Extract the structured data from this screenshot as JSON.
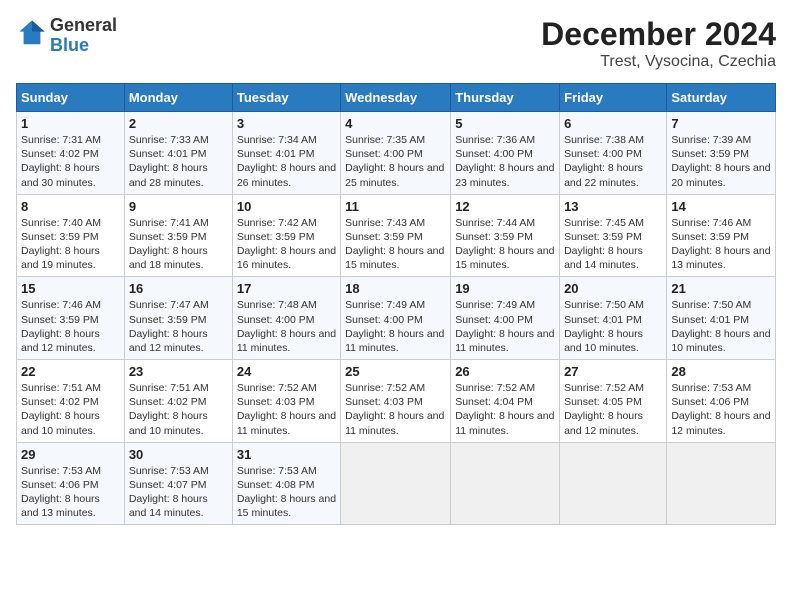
{
  "logo": {
    "general": "General",
    "blue": "Blue"
  },
  "title": "December 2024",
  "subtitle": "Trest, Vysocina, Czechia",
  "weekdays": [
    "Sunday",
    "Monday",
    "Tuesday",
    "Wednesday",
    "Thursday",
    "Friday",
    "Saturday"
  ],
  "weeks": [
    [
      {
        "day": "1",
        "sunrise": "Sunrise: 7:31 AM",
        "sunset": "Sunset: 4:02 PM",
        "daylight": "Daylight: 8 hours and 30 minutes."
      },
      {
        "day": "2",
        "sunrise": "Sunrise: 7:33 AM",
        "sunset": "Sunset: 4:01 PM",
        "daylight": "Daylight: 8 hours and 28 minutes."
      },
      {
        "day": "3",
        "sunrise": "Sunrise: 7:34 AM",
        "sunset": "Sunset: 4:01 PM",
        "daylight": "Daylight: 8 hours and 26 minutes."
      },
      {
        "day": "4",
        "sunrise": "Sunrise: 7:35 AM",
        "sunset": "Sunset: 4:00 PM",
        "daylight": "Daylight: 8 hours and 25 minutes."
      },
      {
        "day": "5",
        "sunrise": "Sunrise: 7:36 AM",
        "sunset": "Sunset: 4:00 PM",
        "daylight": "Daylight: 8 hours and 23 minutes."
      },
      {
        "day": "6",
        "sunrise": "Sunrise: 7:38 AM",
        "sunset": "Sunset: 4:00 PM",
        "daylight": "Daylight: 8 hours and 22 minutes."
      },
      {
        "day": "7",
        "sunrise": "Sunrise: 7:39 AM",
        "sunset": "Sunset: 3:59 PM",
        "daylight": "Daylight: 8 hours and 20 minutes."
      }
    ],
    [
      {
        "day": "8",
        "sunrise": "Sunrise: 7:40 AM",
        "sunset": "Sunset: 3:59 PM",
        "daylight": "Daylight: 8 hours and 19 minutes."
      },
      {
        "day": "9",
        "sunrise": "Sunrise: 7:41 AM",
        "sunset": "Sunset: 3:59 PM",
        "daylight": "Daylight: 8 hours and 18 minutes."
      },
      {
        "day": "10",
        "sunrise": "Sunrise: 7:42 AM",
        "sunset": "Sunset: 3:59 PM",
        "daylight": "Daylight: 8 hours and 16 minutes."
      },
      {
        "day": "11",
        "sunrise": "Sunrise: 7:43 AM",
        "sunset": "Sunset: 3:59 PM",
        "daylight": "Daylight: 8 hours and 15 minutes."
      },
      {
        "day": "12",
        "sunrise": "Sunrise: 7:44 AM",
        "sunset": "Sunset: 3:59 PM",
        "daylight": "Daylight: 8 hours and 15 minutes."
      },
      {
        "day": "13",
        "sunrise": "Sunrise: 7:45 AM",
        "sunset": "Sunset: 3:59 PM",
        "daylight": "Daylight: 8 hours and 14 minutes."
      },
      {
        "day": "14",
        "sunrise": "Sunrise: 7:46 AM",
        "sunset": "Sunset: 3:59 PM",
        "daylight": "Daylight: 8 hours and 13 minutes."
      }
    ],
    [
      {
        "day": "15",
        "sunrise": "Sunrise: 7:46 AM",
        "sunset": "Sunset: 3:59 PM",
        "daylight": "Daylight: 8 hours and 12 minutes."
      },
      {
        "day": "16",
        "sunrise": "Sunrise: 7:47 AM",
        "sunset": "Sunset: 3:59 PM",
        "daylight": "Daylight: 8 hours and 12 minutes."
      },
      {
        "day": "17",
        "sunrise": "Sunrise: 7:48 AM",
        "sunset": "Sunset: 4:00 PM",
        "daylight": "Daylight: 8 hours and 11 minutes."
      },
      {
        "day": "18",
        "sunrise": "Sunrise: 7:49 AM",
        "sunset": "Sunset: 4:00 PM",
        "daylight": "Daylight: 8 hours and 11 minutes."
      },
      {
        "day": "19",
        "sunrise": "Sunrise: 7:49 AM",
        "sunset": "Sunset: 4:00 PM",
        "daylight": "Daylight: 8 hours and 11 minutes."
      },
      {
        "day": "20",
        "sunrise": "Sunrise: 7:50 AM",
        "sunset": "Sunset: 4:01 PM",
        "daylight": "Daylight: 8 hours and 10 minutes."
      },
      {
        "day": "21",
        "sunrise": "Sunrise: 7:50 AM",
        "sunset": "Sunset: 4:01 PM",
        "daylight": "Daylight: 8 hours and 10 minutes."
      }
    ],
    [
      {
        "day": "22",
        "sunrise": "Sunrise: 7:51 AM",
        "sunset": "Sunset: 4:02 PM",
        "daylight": "Daylight: 8 hours and 10 minutes."
      },
      {
        "day": "23",
        "sunrise": "Sunrise: 7:51 AM",
        "sunset": "Sunset: 4:02 PM",
        "daylight": "Daylight: 8 hours and 10 minutes."
      },
      {
        "day": "24",
        "sunrise": "Sunrise: 7:52 AM",
        "sunset": "Sunset: 4:03 PM",
        "daylight": "Daylight: 8 hours and 11 minutes."
      },
      {
        "day": "25",
        "sunrise": "Sunrise: 7:52 AM",
        "sunset": "Sunset: 4:03 PM",
        "daylight": "Daylight: 8 hours and 11 minutes."
      },
      {
        "day": "26",
        "sunrise": "Sunrise: 7:52 AM",
        "sunset": "Sunset: 4:04 PM",
        "daylight": "Daylight: 8 hours and 11 minutes."
      },
      {
        "day": "27",
        "sunrise": "Sunrise: 7:52 AM",
        "sunset": "Sunset: 4:05 PM",
        "daylight": "Daylight: 8 hours and 12 minutes."
      },
      {
        "day": "28",
        "sunrise": "Sunrise: 7:53 AM",
        "sunset": "Sunset: 4:06 PM",
        "daylight": "Daylight: 8 hours and 12 minutes."
      }
    ],
    [
      {
        "day": "29",
        "sunrise": "Sunrise: 7:53 AM",
        "sunset": "Sunset: 4:06 PM",
        "daylight": "Daylight: 8 hours and 13 minutes."
      },
      {
        "day": "30",
        "sunrise": "Sunrise: 7:53 AM",
        "sunset": "Sunset: 4:07 PM",
        "daylight": "Daylight: 8 hours and 14 minutes."
      },
      {
        "day": "31",
        "sunrise": "Sunrise: 7:53 AM",
        "sunset": "Sunset: 4:08 PM",
        "daylight": "Daylight: 8 hours and 15 minutes."
      },
      null,
      null,
      null,
      null
    ]
  ]
}
